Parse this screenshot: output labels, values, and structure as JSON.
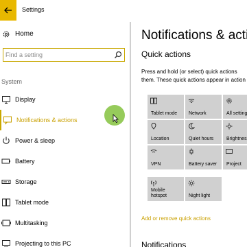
{
  "window": {
    "title": "Settings"
  },
  "left": {
    "home_label": "Home",
    "search_placeholder": "Find a setting",
    "section_label": "System",
    "items": [
      {
        "label": "Display",
        "icon": "display-icon"
      },
      {
        "label": "Notifications & actions",
        "icon": "notifications-icon",
        "selected": true
      },
      {
        "label": "Power & sleep",
        "icon": "power-icon"
      },
      {
        "label": "Battery",
        "icon": "battery-icon"
      },
      {
        "label": "Storage",
        "icon": "storage-icon"
      },
      {
        "label": "Tablet mode",
        "icon": "tablet-mode-icon"
      },
      {
        "label": "Multitasking",
        "icon": "multitasking-icon"
      },
      {
        "label": "Projecting to this PC",
        "icon": "projecting-icon"
      }
    ]
  },
  "main": {
    "title": "Notifications & actions",
    "quick_actions_heading": "Quick actions",
    "quick_actions_desc_1": "Press and hold (or select) quick actions",
    "quick_actions_desc_2": "them. These quick actions appear in action center.",
    "tiles": [
      {
        "label": "Tablet mode",
        "icon": "tablet-mode-icon"
      },
      {
        "label": "Network",
        "icon": "network-icon"
      },
      {
        "label": "All settings",
        "icon": "settings-icon"
      },
      {
        "label": "Location",
        "icon": "location-icon"
      },
      {
        "label": "Quiet hours",
        "icon": "moon-icon"
      },
      {
        "label": "Brightness",
        "icon": "brightness-icon"
      },
      {
        "label": "VPN",
        "icon": "vpn-icon"
      },
      {
        "label": "Battery saver",
        "icon": "battery-saver-icon"
      },
      {
        "label": "Project",
        "icon": "project-icon"
      },
      {
        "label": "Mobile\nhotspot",
        "icon": "hotspot-icon"
      },
      {
        "label": "Night light",
        "icon": "night-light-icon"
      }
    ],
    "add_remove_link": "Add or remove quick actions",
    "notifications_heading": "Notifications"
  },
  "colors": {
    "accent": "#c9a800",
    "tile_bg": "#d0d0d0",
    "cursor_highlight": "#84c23e"
  }
}
